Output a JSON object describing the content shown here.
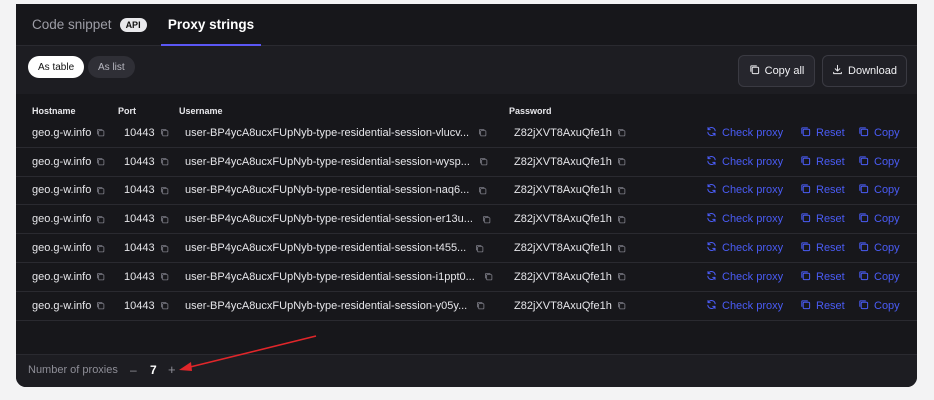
{
  "tabs": {
    "code_snippet": "Code snippet",
    "api_badge": "API",
    "proxy_strings": "Proxy strings"
  },
  "view": {
    "as_table": "As table",
    "as_list": "As list"
  },
  "actions": {
    "copy_all": "Copy all",
    "download": "Download"
  },
  "table": {
    "headers": {
      "hostname": "Hostname",
      "port": "Port",
      "username": "Username",
      "password": "Password"
    },
    "rows": [
      {
        "hostname": "geo.g-w.info",
        "port": "10443",
        "username": "user-BP4ycA8ucxFUpNyb-type-residential-session-vlucv...",
        "password": "Z82jXVT8AxuQfe1h"
      },
      {
        "hostname": "geo.g-w.info",
        "port": "10443",
        "username": "user-BP4ycA8ucxFUpNyb-type-residential-session-wysp...",
        "password": "Z82jXVT8AxuQfe1h"
      },
      {
        "hostname": "geo.g-w.info",
        "port": "10443",
        "username": "user-BP4ycA8ucxFUpNyb-type-residential-session-naq6...",
        "password": "Z82jXVT8AxuQfe1h"
      },
      {
        "hostname": "geo.g-w.info",
        "port": "10443",
        "username": "user-BP4ycA8ucxFUpNyb-type-residential-session-er13u...",
        "password": "Z82jXVT8AxuQfe1h"
      },
      {
        "hostname": "geo.g-w.info",
        "port": "10443",
        "username": "user-BP4ycA8ucxFUpNyb-type-residential-session-t455...",
        "password": "Z82jXVT8AxuQfe1h"
      },
      {
        "hostname": "geo.g-w.info",
        "port": "10443",
        "username": "user-BP4ycA8ucxFUpNyb-type-residential-session-i1ppt0...",
        "password": "Z82jXVT8AxuQfe1h"
      },
      {
        "hostname": "geo.g-w.info",
        "port": "10443",
        "username": "user-BP4ycA8ucxFUpNyb-type-residential-session-y05y...",
        "password": "Z82jXVT8AxuQfe1h"
      }
    ],
    "row_actions": {
      "check_proxy": "Check proxy",
      "reset": "Reset",
      "copy": "Copy"
    }
  },
  "footer": {
    "label": "Number of proxies",
    "minus": "–",
    "count": "7",
    "plus": "+"
  },
  "icons": {
    "copy": "copy-icon",
    "download": "download-icon",
    "refresh": "refresh-icon"
  },
  "colors": {
    "accent": "#4a5cf5",
    "tab_underline": "#5b57f5",
    "card_bg": "#17171b",
    "annotation_arrow": "#e0262a"
  }
}
